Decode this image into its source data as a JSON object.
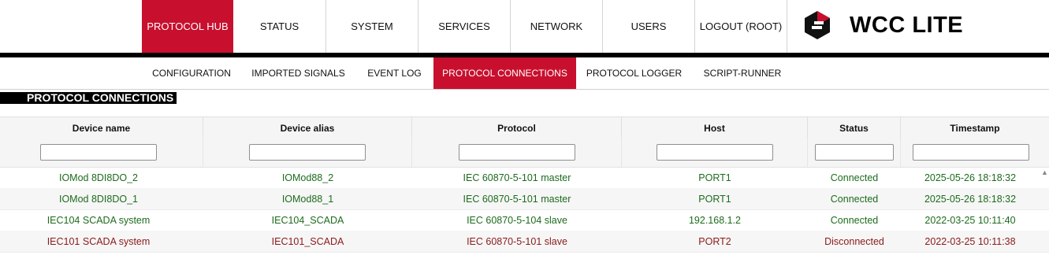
{
  "topnav": {
    "items": [
      {
        "label": "PROTOCOL HUB"
      },
      {
        "label": "STATUS"
      },
      {
        "label": "SYSTEM"
      },
      {
        "label": "SERVICES"
      },
      {
        "label": "NETWORK"
      },
      {
        "label": "USERS"
      },
      {
        "label": "LOGOUT (ROOT)"
      }
    ],
    "brand": "WCC LITE",
    "brand_icon": "wcc-logo-icon",
    "accent_color": "#c8102e"
  },
  "subnav": {
    "items": [
      {
        "label": "CONFIGURATION"
      },
      {
        "label": "IMPORTED SIGNALS"
      },
      {
        "label": "EVENT LOG"
      },
      {
        "label": "PROTOCOL CONNECTIONS"
      },
      {
        "label": "PROTOCOL LOGGER"
      },
      {
        "label": "SCRIPT-RUNNER"
      }
    ]
  },
  "section": {
    "title": "PROTOCOL CONNECTIONS"
  },
  "table": {
    "columns": [
      "Device name",
      "Device alias",
      "Protocol",
      "Host",
      "Status",
      "Timestamp"
    ],
    "filters": [
      "",
      "",
      "",
      "",
      "",
      ""
    ],
    "rows": [
      {
        "cells": [
          "IOMod 8DI8DO_2",
          "IOMod88_2",
          "IEC 60870-5-101 master",
          "PORT1",
          "Connected",
          "2025-05-26 18:18:32"
        ]
      },
      {
        "cells": [
          "IOMod 8DI8DO_1",
          "IOMod88_1",
          "IEC 60870-5-101 master",
          "PORT1",
          "Connected",
          "2025-05-26 18:18:32"
        ]
      },
      {
        "cells": [
          "IEC104 SCADA system",
          "IEC104_SCADA",
          "IEC 60870-5-104 slave",
          "192.168.1.2",
          "Connected",
          "2022-03-25 10:11:40"
        ]
      },
      {
        "cells": [
          "IEC101 SCADA system",
          "IEC101_SCADA",
          "IEC 60870-5-101 slave",
          "PORT2",
          "Disconnected",
          "2022-03-25 10:11:38"
        ]
      }
    ],
    "status_colors": {
      "connected": "#1d6b1d",
      "disconnected": "#8b1a1a"
    }
  }
}
